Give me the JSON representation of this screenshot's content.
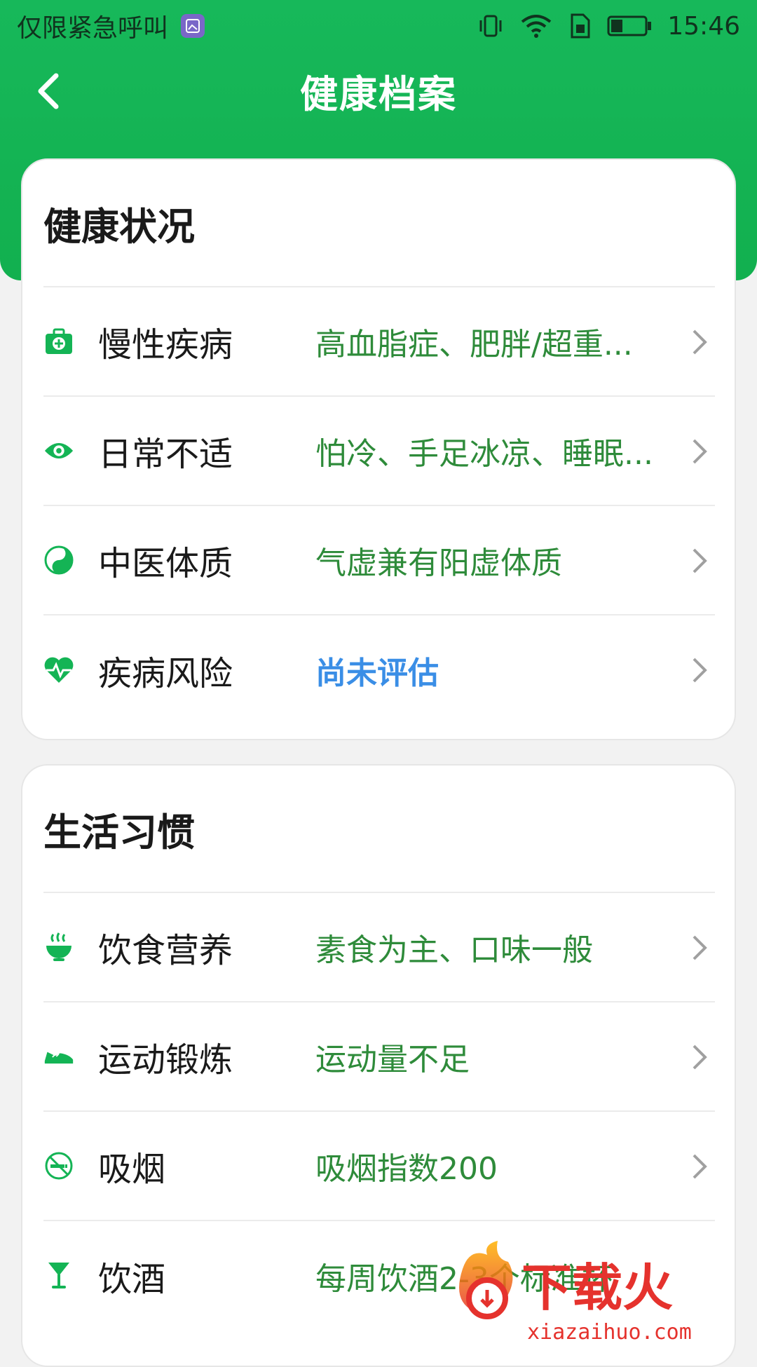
{
  "status": {
    "carrier": "仅限紧急呼叫",
    "time": "15:46"
  },
  "header": {
    "title": "健康档案"
  },
  "health": {
    "title": "健康状况",
    "rows": [
      {
        "label": "慢性疾病",
        "value": "高血脂症、肥胖/超重..."
      },
      {
        "label": "日常不适",
        "value": "怕冷、手足冰凉、睡眠..."
      },
      {
        "label": "中医体质",
        "value": "气虚兼有阳虚体质"
      },
      {
        "label": "疾病风险",
        "value": "尚未评估"
      }
    ]
  },
  "habits": {
    "title": "生活习惯",
    "rows": [
      {
        "label": "饮食营养",
        "value": "素食为主、口味一般"
      },
      {
        "label": "运动锻炼",
        "value": "运动量不足"
      },
      {
        "label": "吸烟",
        "value": "吸烟指数200"
      },
      {
        "label": "饮酒",
        "value": "每周饮酒2-3个标准杯"
      }
    ]
  },
  "watermark": {
    "brand": "下载火",
    "url": "xiazaihuo.com"
  },
  "colors": {
    "accent": "#14b455",
    "value_green": "#2e8b3a",
    "value_blue": "#3a8ee6"
  }
}
